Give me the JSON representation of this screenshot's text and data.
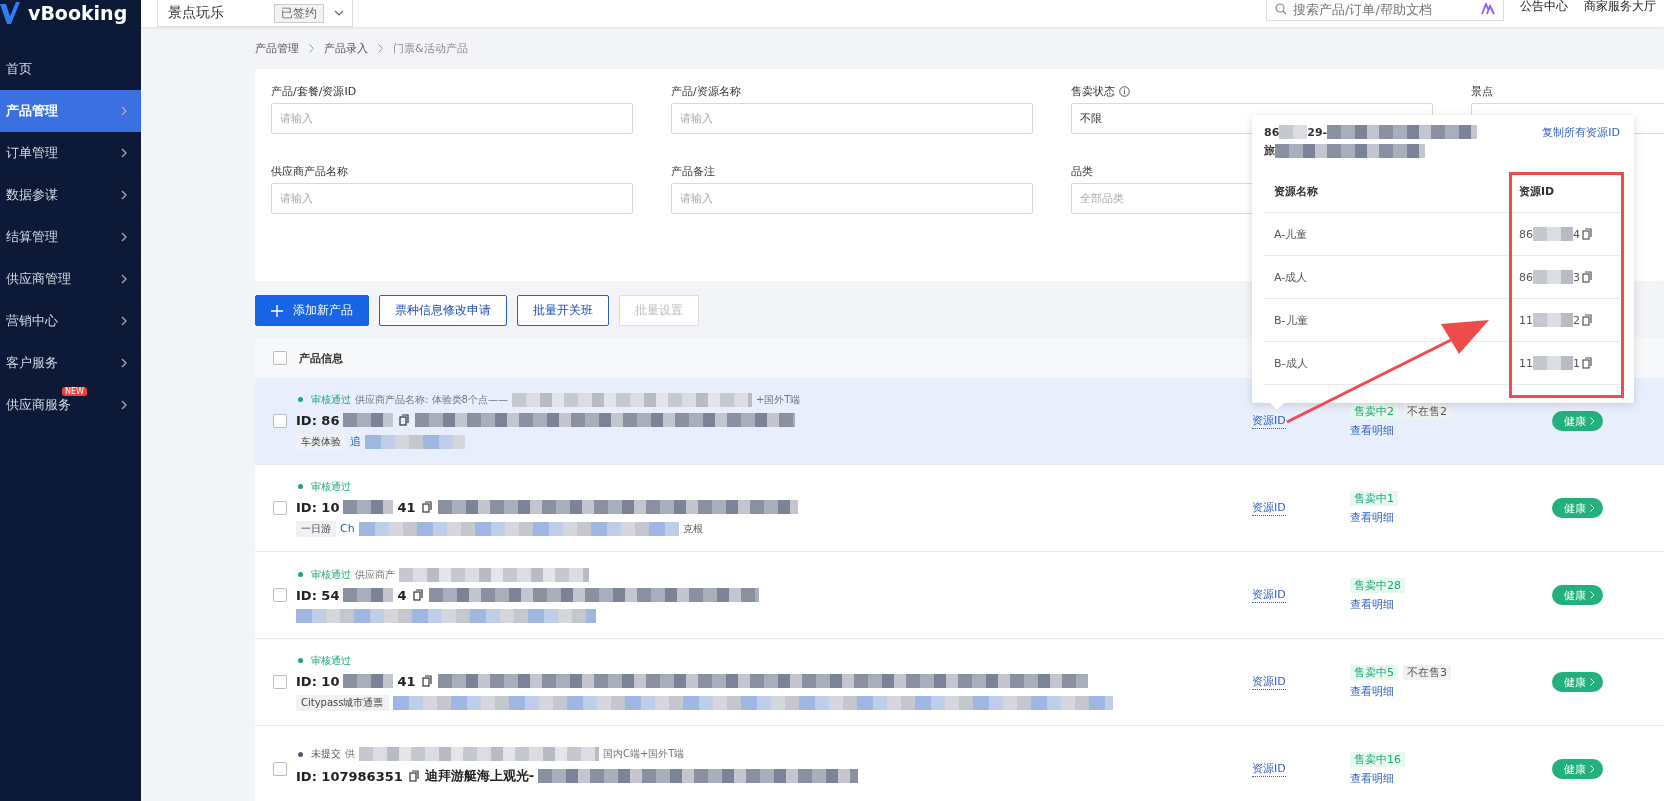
{
  "logo": {
    "text": "vBooking"
  },
  "top_bar": {
    "business": {
      "label": "景点玩乐",
      "badge": "已签约"
    },
    "search": {
      "placeholder": "搜索产品/订单/帮助文档"
    },
    "links": [
      "公告中心",
      "商家服务大厅"
    ]
  },
  "sidebar": {
    "items": [
      {
        "label": "首页",
        "selected": false,
        "has_arrow": false
      },
      {
        "label": "产品管理",
        "selected": true,
        "has_arrow": true
      },
      {
        "label": "订单管理",
        "selected": false,
        "has_arrow": true
      },
      {
        "label": "数据参谋",
        "selected": false,
        "has_arrow": true
      },
      {
        "label": "结算管理",
        "selected": false,
        "has_arrow": true
      },
      {
        "label": "供应商管理",
        "selected": false,
        "has_arrow": true
      },
      {
        "label": "营销中心",
        "selected": false,
        "has_arrow": true
      },
      {
        "label": "客户服务",
        "selected": false,
        "has_arrow": true
      },
      {
        "label": "供应商服务",
        "selected": false,
        "has_arrow": true,
        "badge": "NEW"
      }
    ]
  },
  "breadcrumb": [
    "产品管理",
    "产品录入",
    "门票&活动产品"
  ],
  "filters": [
    {
      "label": "产品/套餐/资源ID",
      "placeholder": "请输入"
    },
    {
      "label": "产品/资源名称",
      "placeholder": "请输入"
    },
    {
      "label": "售卖状态",
      "value": "不限",
      "info": true
    },
    {
      "label": "景点"
    },
    {
      "label": "供应商产品名称",
      "placeholder": "请输入"
    },
    {
      "label": "产品备注",
      "placeholder": "请输入"
    },
    {
      "label": "品类",
      "placeholder": "全部品类"
    }
  ],
  "actions": [
    {
      "label": "添加新产品",
      "kind": "primary",
      "disabled": false
    },
    {
      "label": "票种信息修改申请",
      "kind": "outline",
      "disabled": false
    },
    {
      "label": "批量开关班",
      "kind": "outline",
      "disabled": false
    },
    {
      "label": "批量设置",
      "kind": "outline",
      "disabled": true
    }
  ],
  "table": {
    "header": "产品信息",
    "select_all": {
      "checked": false
    },
    "rows": [
      {
        "checked": false,
        "highlighted": true,
        "status": {
          "kind": "approved",
          "label": "审核通过"
        },
        "supplier": "供应商产品名称: 体验类8个点——",
        "supplier_end": "+国外T端",
        "id_start": "ID: 86",
        "tag": "车类体验",
        "link": "追",
        "resource": "资源ID",
        "on_sale": "售卖中2",
        "off_sale": "不在售2",
        "detail": "查看明细",
        "health": "健康"
      },
      {
        "checked": false,
        "highlighted": false,
        "status": {
          "kind": "approved",
          "label": "审核通过"
        },
        "id_start": "ID: 10",
        "id_end": "41",
        "tag": "一日游",
        "link": "Ch",
        "link_end": "克根",
        "resource": "资源ID",
        "on_sale": "售卖中1",
        "detail": "查看明细",
        "health": "健康"
      },
      {
        "checked": false,
        "highlighted": false,
        "status": {
          "kind": "approved",
          "label": "审核通过"
        },
        "supplier": "供应商产",
        "id_start": "ID: 54",
        "id_end": "4",
        "resource": "资源ID",
        "on_sale": "售卖中28",
        "detail": "查看明细",
        "health": "健康"
      },
      {
        "checked": false,
        "highlighted": false,
        "status": {
          "kind": "approved",
          "label": "审核通过"
        },
        "id_start": "ID: 10",
        "id_end": "41",
        "tag": "Citypass城市通票",
        "resource": "资源ID",
        "on_sale": "售卖中5",
        "off_sale": "不在售3",
        "detail": "查看明细",
        "health": "健康"
      },
      {
        "checked": false,
        "highlighted": false,
        "status": {
          "kind": "draft",
          "label": "未提交"
        },
        "supplier": "供",
        "supplier_end": "国内C端+国外T端",
        "id_start": "ID: 107986351",
        "title": "迪拜游艇海上观光-",
        "resource": "资源ID",
        "on_sale": "售卖中16",
        "detail": "查看明细",
        "health": "健康"
      }
    ]
  },
  "popover": {
    "line_1": "86",
    "line_1_mid": "29-",
    "line_2": "旅",
    "copy_all": "复制所有资源ID",
    "columns": [
      "资源名称",
      "资源ID"
    ],
    "rows": [
      {
        "name": "A-儿童",
        "id_start": "86",
        "id_end": "4"
      },
      {
        "name": "A-成人",
        "id_start": "86",
        "id_end": "3"
      },
      {
        "name": "B-儿童",
        "id_start": "11",
        "id_end": "2"
      },
      {
        "name": "B-成人",
        "id_start": "11",
        "id_end": "1"
      }
    ]
  }
}
